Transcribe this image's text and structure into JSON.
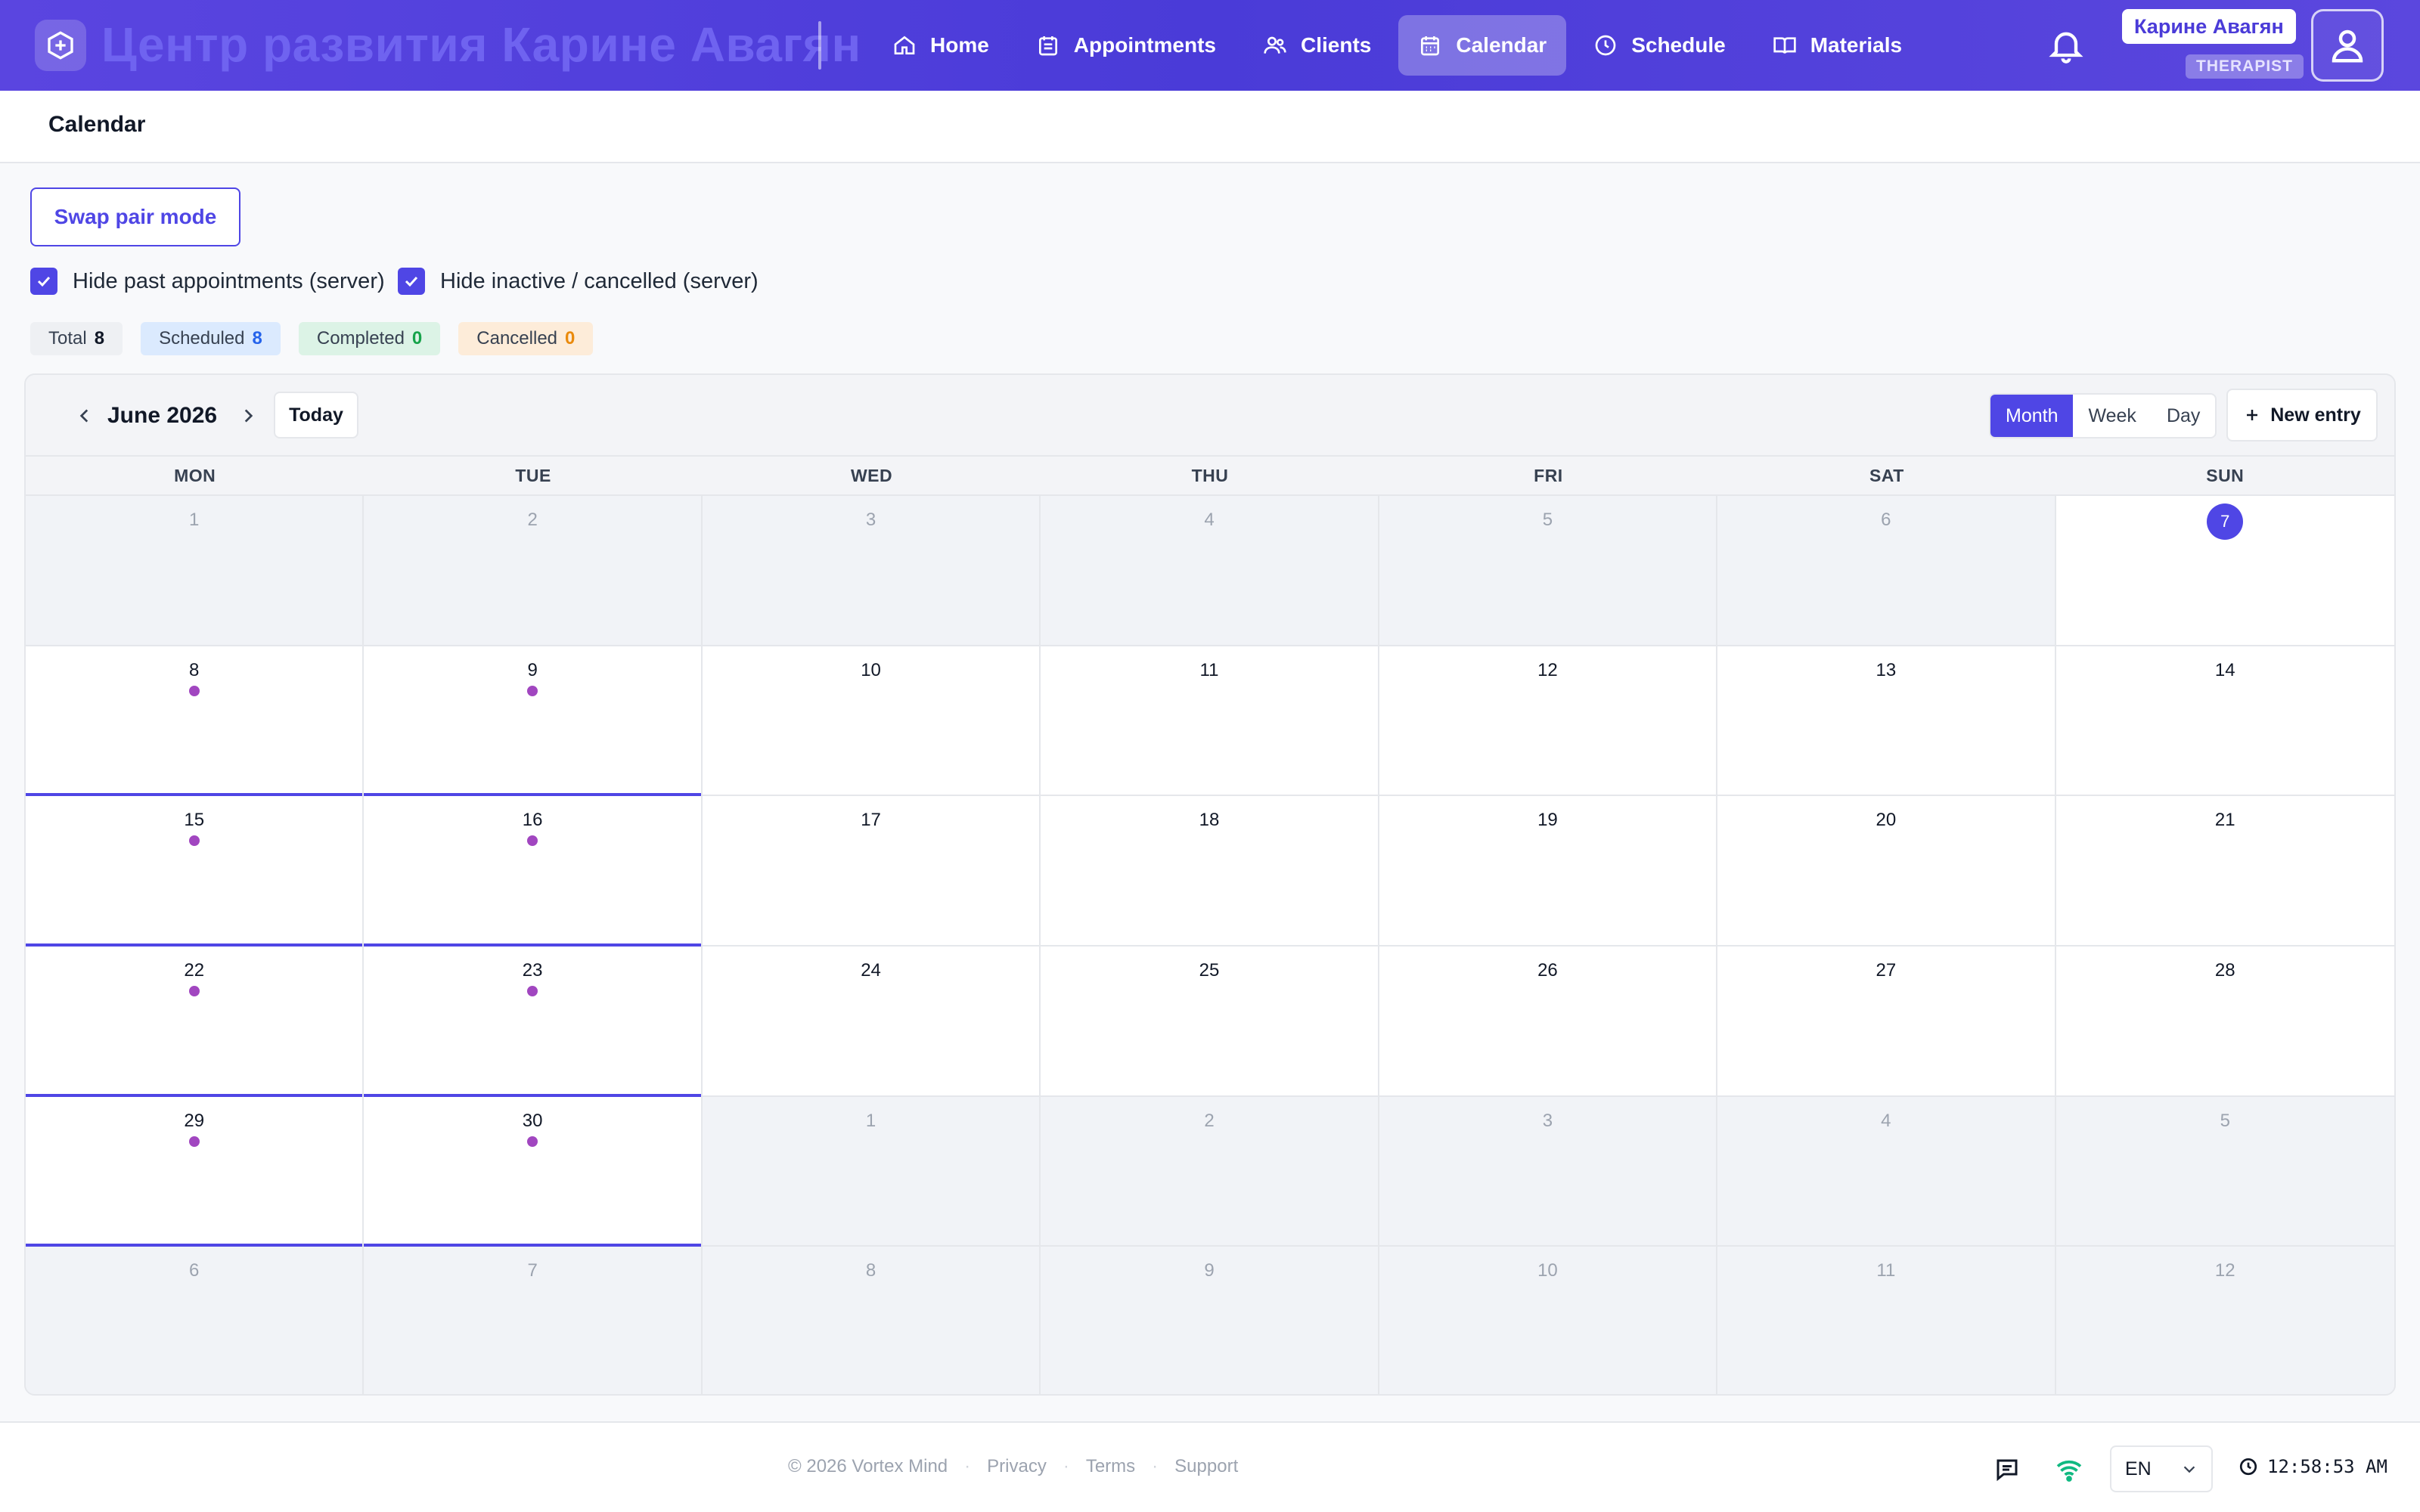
{
  "brand": {
    "title": "Центр развития Карине Авагян"
  },
  "nav": [
    {
      "label": "Home",
      "icon": "home-icon",
      "active": false
    },
    {
      "label": "Appointments",
      "icon": "calendar-list-icon",
      "active": false
    },
    {
      "label": "Clients",
      "icon": "users-icon",
      "active": false
    },
    {
      "label": "Calendar",
      "icon": "calendar-icon",
      "active": true
    },
    {
      "label": "Schedule",
      "icon": "clock-icon",
      "active": false
    },
    {
      "label": "Materials",
      "icon": "book-icon",
      "active": false
    }
  ],
  "user": {
    "name": "Карине Авагян",
    "role": "THERAPIST"
  },
  "page": {
    "title": "Calendar"
  },
  "controls": {
    "swap_label": "Swap pair mode",
    "hide_past_label": "Hide past appointments (server)",
    "hide_inactive_label": "Hide inactive / cancelled (server)"
  },
  "stats": [
    {
      "label": "Total",
      "value": "8",
      "bg": "#eef0f3",
      "fg": "#111827"
    },
    {
      "label": "Scheduled",
      "value": "8",
      "bg": "#dbeafe",
      "fg": "#2563eb"
    },
    {
      "label": "Completed",
      "value": "0",
      "bg": "#dcf3e6",
      "fg": "#16a34a"
    },
    {
      "label": "Cancelled",
      "value": "0",
      "bg": "#fdecd9",
      "fg": "#ea8a0c"
    }
  ],
  "calendar": {
    "month_label": "June 2026",
    "today_label": "Today",
    "views": [
      "Month",
      "Week",
      "Day"
    ],
    "active_view": "Month",
    "new_entry_label": "New entry",
    "weekdays": [
      "MON",
      "TUE",
      "WED",
      "THU",
      "FRI",
      "SAT",
      "SUN"
    ],
    "days": [
      {
        "d": "1",
        "out": true
      },
      {
        "d": "2",
        "out": true
      },
      {
        "d": "3",
        "out": true
      },
      {
        "d": "4",
        "out": true
      },
      {
        "d": "5",
        "out": true
      },
      {
        "d": "6",
        "out": true
      },
      {
        "d": "7",
        "today": true
      },
      {
        "d": "8",
        "dot": true,
        "hl": true
      },
      {
        "d": "9",
        "dot": true,
        "hl": true
      },
      {
        "d": "10"
      },
      {
        "d": "11"
      },
      {
        "d": "12"
      },
      {
        "d": "13"
      },
      {
        "d": "14"
      },
      {
        "d": "15",
        "dot": true,
        "hl": true
      },
      {
        "d": "16",
        "dot": true,
        "hl": true
      },
      {
        "d": "17"
      },
      {
        "d": "18"
      },
      {
        "d": "19"
      },
      {
        "d": "20"
      },
      {
        "d": "21"
      },
      {
        "d": "22",
        "dot": true,
        "hl": true
      },
      {
        "d": "23",
        "dot": true,
        "hl": true
      },
      {
        "d": "24"
      },
      {
        "d": "25"
      },
      {
        "d": "26"
      },
      {
        "d": "27"
      },
      {
        "d": "28"
      },
      {
        "d": "29",
        "dot": true,
        "hl": true
      },
      {
        "d": "30",
        "dot": true,
        "hl": true
      },
      {
        "d": "1",
        "out": true
      },
      {
        "d": "2",
        "out": true
      },
      {
        "d": "3",
        "out": true
      },
      {
        "d": "4",
        "out": true
      },
      {
        "d": "5",
        "out": true
      },
      {
        "d": "6",
        "out": true
      },
      {
        "d": "7",
        "out": true
      },
      {
        "d": "8",
        "out": true
      },
      {
        "d": "9",
        "out": true
      },
      {
        "d": "10",
        "out": true
      },
      {
        "d": "11",
        "out": true
      },
      {
        "d": "12",
        "out": true
      }
    ]
  },
  "footer": {
    "copyright": "© 2026 Vortex Mind",
    "links": [
      "Privacy",
      "Terms",
      "Support"
    ],
    "language": "EN",
    "time": "12:58:53 AM"
  },
  "colors": {
    "accent": "#4f46e5",
    "event_dot": "#a146c0",
    "online": "#10b981"
  }
}
